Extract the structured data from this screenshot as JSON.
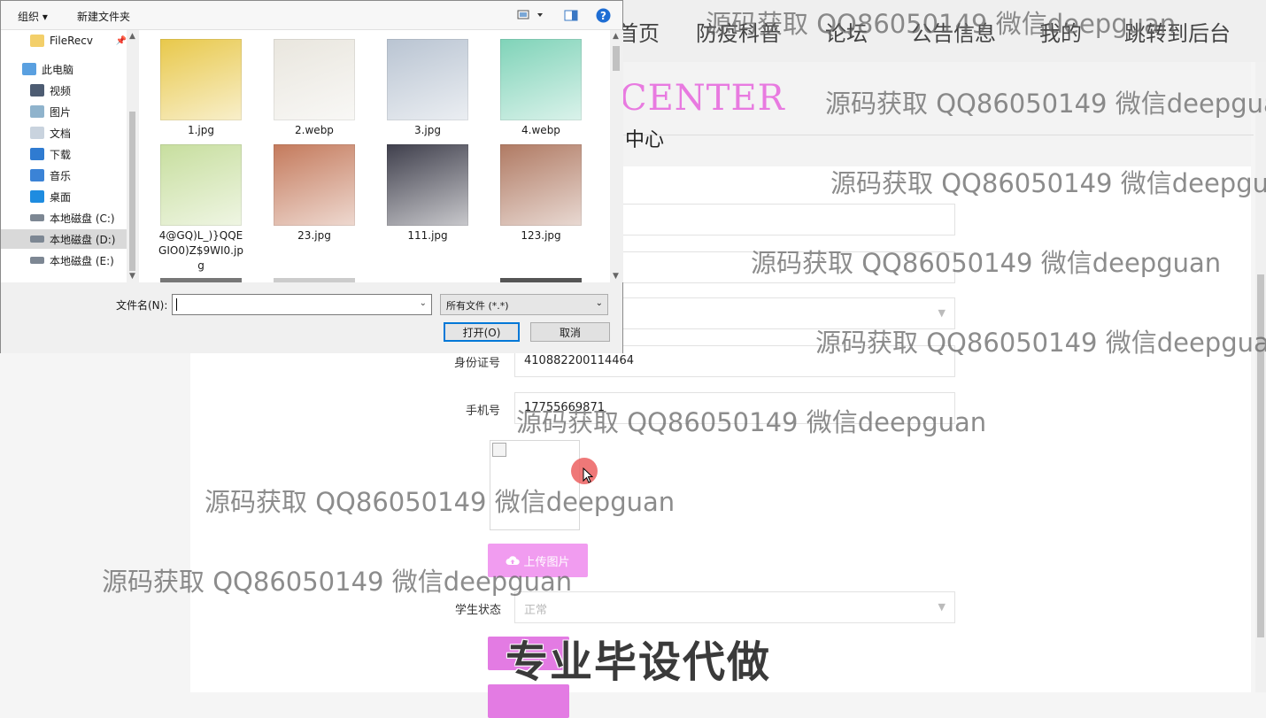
{
  "nav": {
    "items": [
      "首页",
      "防疫科普",
      "论坛",
      "公告信息",
      "我的",
      "跳转到后台"
    ]
  },
  "header": {
    "title": "CENTER",
    "subtitle": "中心"
  },
  "form": {
    "id_label": "身份证号",
    "id_value": "410882200114464",
    "phone_label": "手机号",
    "phone_value": "17755669871",
    "upload_label": "上传图片",
    "status_label": "学生状态",
    "status_value": "正常"
  },
  "watermark_text": "源码获取 QQ86050149 微信deepguan",
  "promo_text": "专业毕设代做",
  "dialog": {
    "organize_label": "组织 ▾",
    "new_folder_label": "新建文件夹",
    "tree": [
      {
        "label": "FileRecv",
        "icon": "folder-icon"
      },
      {
        "label": "此电脑",
        "icon": "computer-icon"
      },
      {
        "label": "视频",
        "icon": "video-icon"
      },
      {
        "label": "图片",
        "icon": "pictures-icon"
      },
      {
        "label": "文档",
        "icon": "documents-icon"
      },
      {
        "label": "下载",
        "icon": "download-icon"
      },
      {
        "label": "音乐",
        "icon": "music-icon"
      },
      {
        "label": "桌面",
        "icon": "desktop-icon"
      },
      {
        "label": "本地磁盘 (C:)",
        "icon": "drive-icon"
      },
      {
        "label": "本地磁盘 (D:)",
        "icon": "drive-icon"
      },
      {
        "label": "本地磁盘 (E:)",
        "icon": "drive-icon"
      }
    ],
    "files": [
      {
        "name": "1.jpg",
        "color": "#e8c84a"
      },
      {
        "name": "2.webp",
        "color": "#e9e6de"
      },
      {
        "name": "3.jpg",
        "color": "#b9c4d2"
      },
      {
        "name": "4.webp",
        "color": "#7fd3b8"
      },
      {
        "name": "4@GQ)L_)}QQEGIO0)Z$9WI0.jpg",
        "color": "#c7de9e"
      },
      {
        "name": "23.jpg",
        "color": "#c47a5c"
      },
      {
        "name": "111.jpg",
        "color": "#3f3f4c"
      },
      {
        "name": "123.jpg",
        "color": "#b07a63"
      }
    ],
    "filename_label": "文件名(N):",
    "filename_value": "",
    "filetype_value": "所有文件 (*.*)",
    "open_label": "打开(O)",
    "cancel_label": "取消"
  },
  "colors": {
    "accent_pink": "#e87ae0",
    "button_pink": "#f19cf0",
    "dialog_blue": "#0078d7"
  }
}
